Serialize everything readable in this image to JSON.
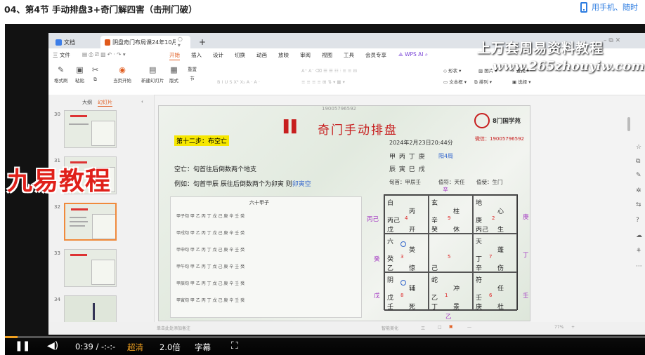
{
  "page": {
    "title": "04、第4节 手动排盘3+奇门解四害（击刑门破）",
    "phone_link": "用手机、随时"
  },
  "wps": {
    "tabs": [
      {
        "label": "文档"
      },
      {
        "label": "阴盘奇门布局课24年10月」"
      }
    ],
    "tab_extra": "○ ▾",
    "new_tab": "+",
    "menu": [
      "三 文件",
      "开始",
      "插入",
      "设计",
      "切换",
      "动画",
      "放映",
      "审阅",
      "视图",
      "工具",
      "会员专享",
      "WPS AI"
    ],
    "ribbon": {
      "format_painter": "格式刷",
      "paste": "粘贴",
      "start_from": "当页开始",
      "new_slide": "新建幻灯片",
      "layout": "版式",
      "section": "节",
      "reset": "重置",
      "shape": "形状",
      "picture": "图片",
      "find": "查找",
      "textbox": "文本框",
      "arrange": "排列",
      "select": "选择"
    },
    "left_pane": {
      "tab_outline": "大纲",
      "tab_slides": "幻灯片",
      "collapse": "‹",
      "thumbnails": [
        {
          "num": "30"
        },
        {
          "num": "31"
        },
        {
          "num": "32"
        },
        {
          "num": "33"
        },
        {
          "num": "34"
        }
      ],
      "add": "+"
    },
    "status_left": "单击此处添加备注",
    "status_items": [
      "智能美化",
      "三",
      "□",
      "▣",
      "—",
      "77%",
      "+"
    ]
  },
  "watermark": {
    "line1": "上万套周易资料教程",
    "line2": "www.265zhouyiw.com",
    "brand_overlay": "九易教程"
  },
  "slide": {
    "top_phone": "19005796592",
    "title_mark": "▌▌",
    "title": "奇门手动排盘",
    "logo_text": "8门国学苑",
    "wechat_label": "微信：",
    "wechat": "19005796592",
    "step": "第十二步：布空亡",
    "datetime": "2024年2月23日20:44分",
    "ganzhi1": "甲 丙 丁 庚",
    "ju": "阳4局",
    "ganzhi2": "辰 寅 巳 戌",
    "xunshou": "旬首：甲辰壬",
    "zhifu": "值符：天任",
    "zhishi": "值使：生门",
    "kongwang_text": "空亡：旬首往后倒数两个地支",
    "example_text": "例如：旬首甲辰 辰往后倒数两个为卯寅 则",
    "example_highlight": "卯寅空",
    "table_title": "六十甲子",
    "table_rows": [
      "甲子旬  甲 乙 丙 丁 戊 己 庚 辛 壬 癸",
      "甲戌旬  甲 乙 丙 丁 戊 己 庚 辛 壬 癸",
      "甲申旬  甲 乙 丙 丁 戊 己 庚 辛 壬 癸",
      "甲午旬  甲 乙 丙 丁 戊 己 庚 辛 壬 癸",
      "甲辰旬  甲 乙 丙 丁 戊 己 庚 辛 壬 癸",
      "甲寅旬  甲 乙 丙 丁 戊 己 庚 辛 壬 癸"
    ],
    "side_labels": {
      "top": "辛",
      "left_top": "丙己",
      "left_mid": "癸",
      "left_bot": "戊",
      "right_top": "庚",
      "right_mid": "丁",
      "right_bot": "壬",
      "bottom": "乙"
    },
    "palaces": [
      {
        "god": "白",
        "star": "丙",
        "stem": "丙己",
        "num": "4",
        "door": "开",
        "base": "戊"
      },
      {
        "god": "玄",
        "star": "柱",
        "stem": "辛",
        "num": "9",
        "door": "休",
        "base": "癸"
      },
      {
        "god": "地",
        "star": "心",
        "stem": "庚",
        "num": "2",
        "door": "生",
        "base": "丙己"
      },
      {
        "god": "六",
        "star": "英",
        "stem": "癸",
        "num": "3",
        "door": "惊",
        "base": "乙"
      },
      {
        "god": "",
        "star": "",
        "stem": "",
        "num": "5",
        "door": "",
        "base": "己"
      },
      {
        "god": "天",
        "star": "蓬",
        "stem": "丁",
        "num": "7",
        "door": "伤",
        "base": "辛"
      },
      {
        "god": "阴",
        "star": "辅",
        "stem": "戊",
        "num": "8",
        "door": "死",
        "base": "壬"
      },
      {
        "god": "蛇",
        "star": "冲",
        "stem": "乙",
        "num": "1",
        "door": "景",
        "base": "丁"
      },
      {
        "god": "符",
        "star": "任",
        "stem": "壬",
        "num": "6",
        "door": "杜",
        "base": "庚"
      }
    ]
  },
  "player": {
    "time_current": "0:39",
    "time_total": "-:-:-",
    "quality": "超清",
    "speed": "2.0倍",
    "subtitle": "字幕",
    "progress": 0.02
  }
}
